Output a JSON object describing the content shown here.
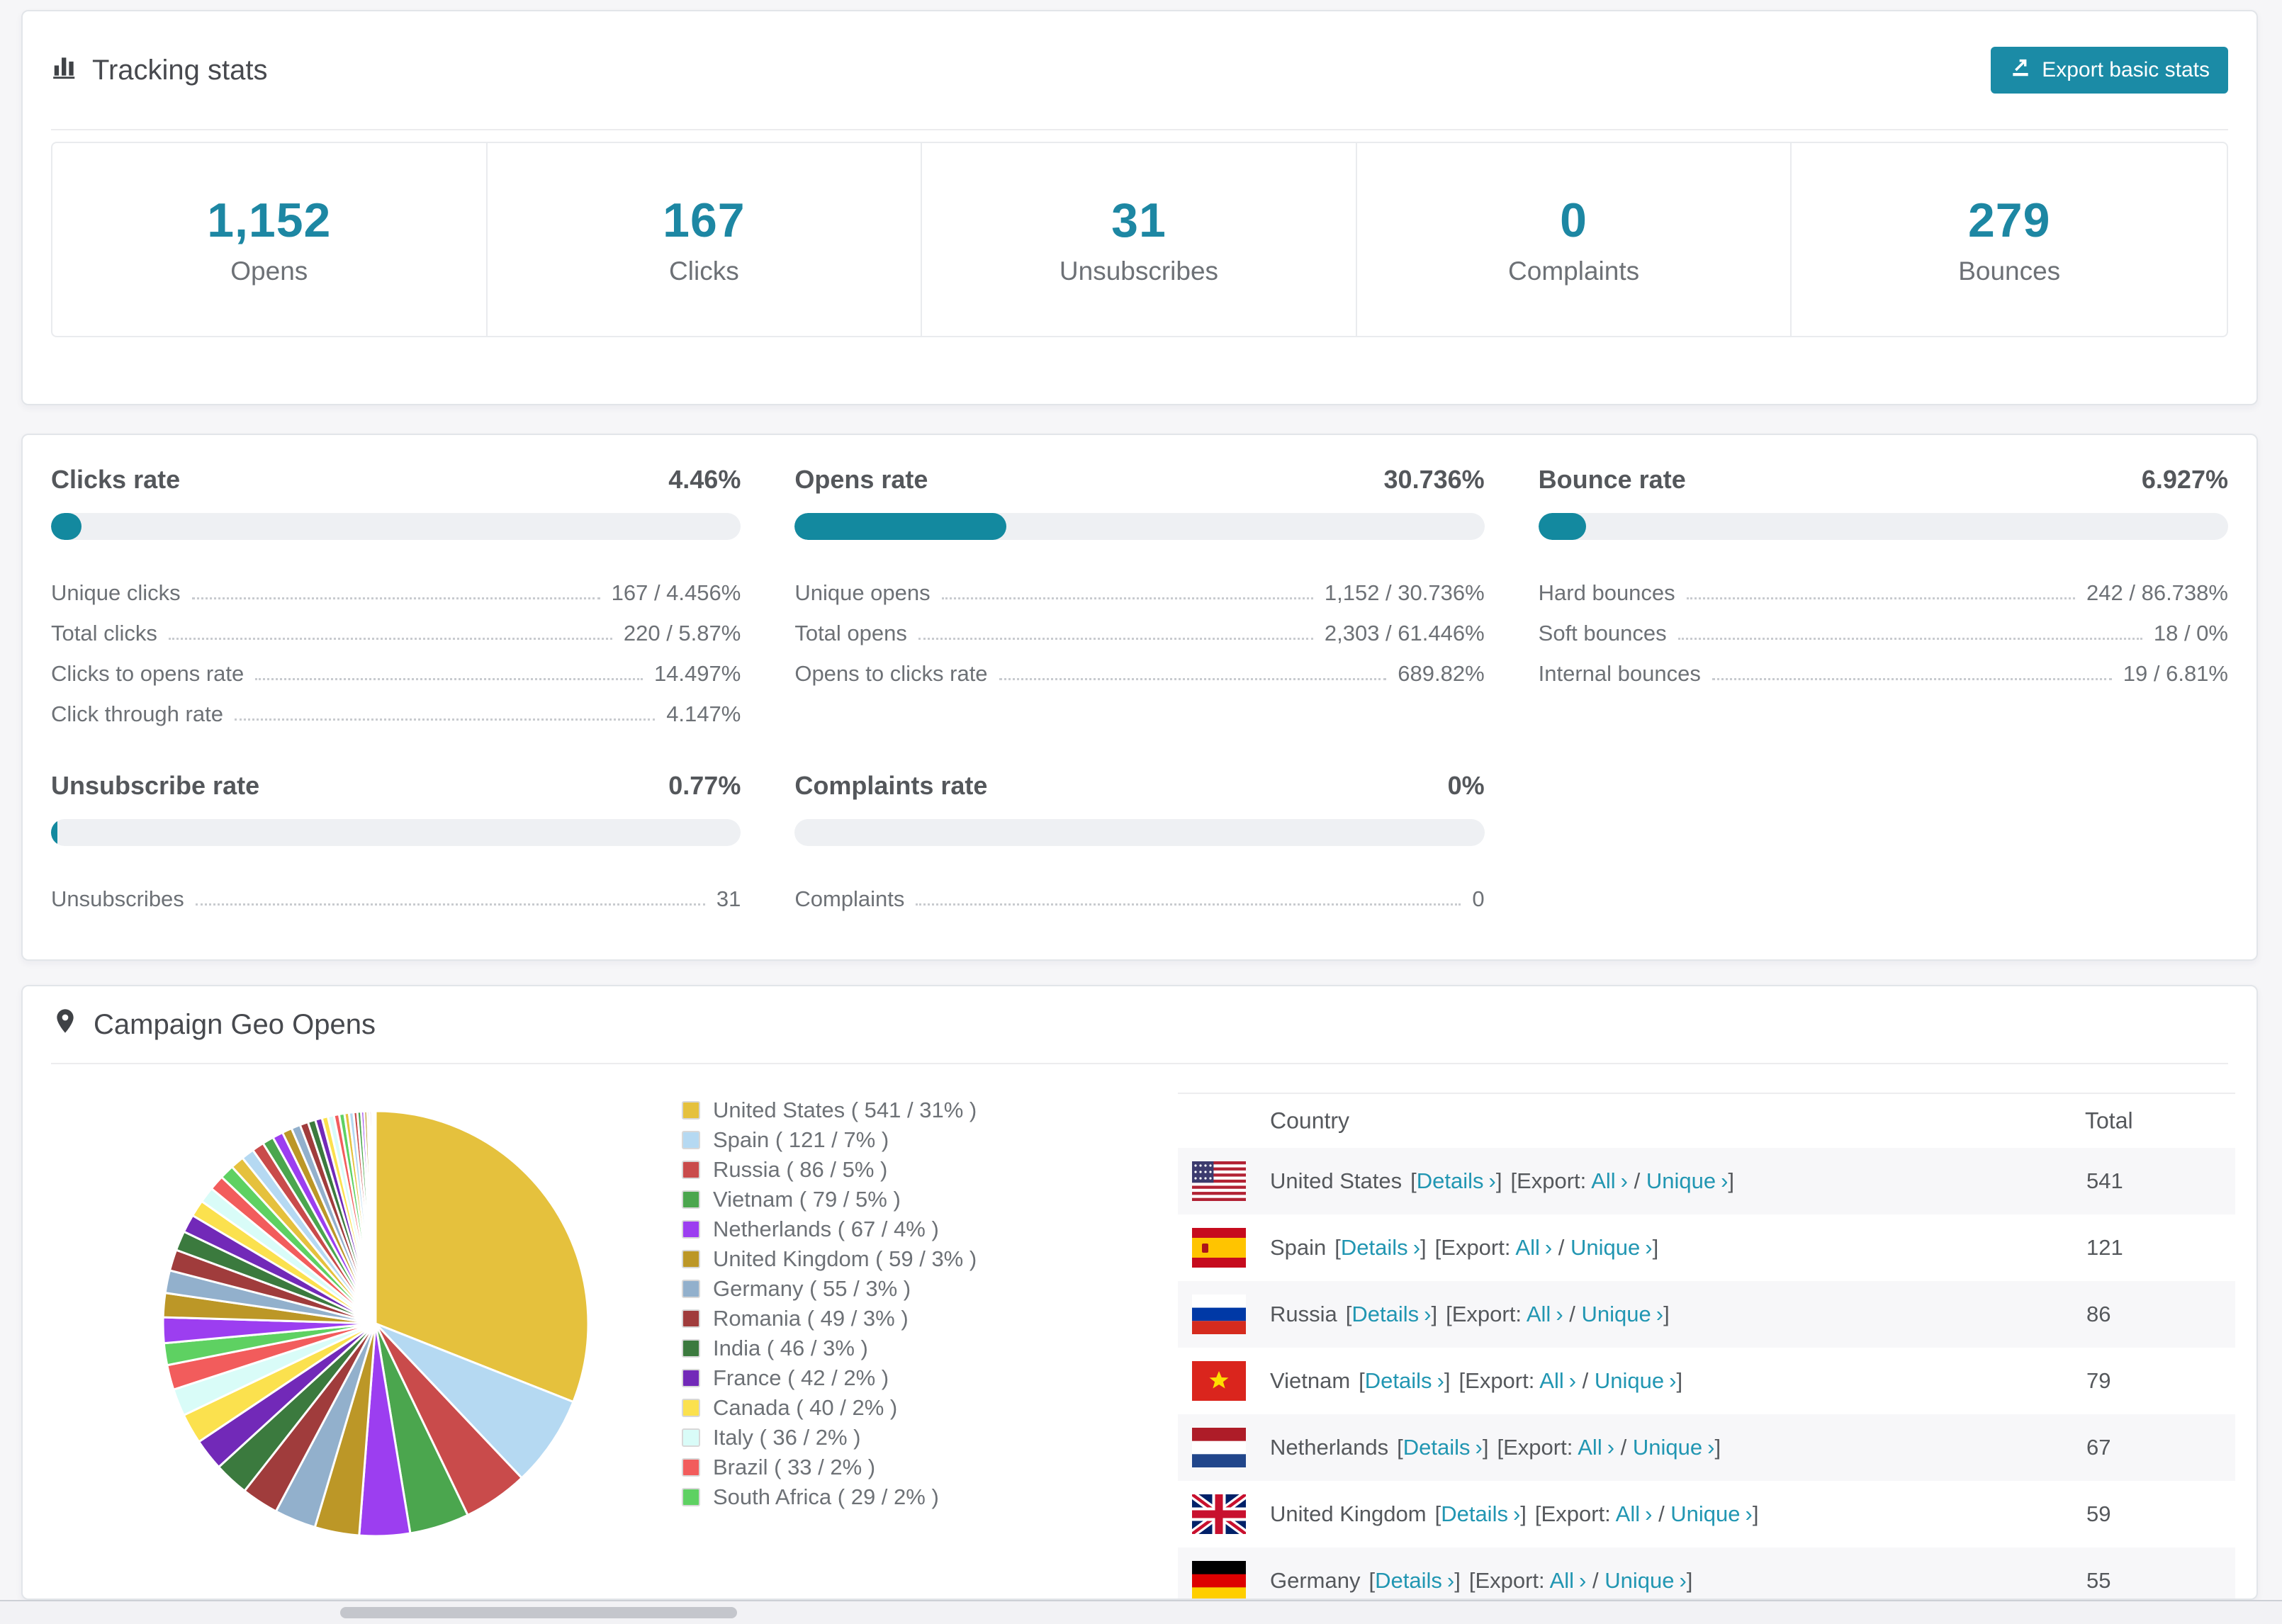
{
  "colors": {
    "accent": "#1b8ba6",
    "stat_number": "#1d87a3",
    "link": "#2196b2"
  },
  "tracking": {
    "title": "Tracking stats",
    "export_button": "Export basic stats",
    "stats": [
      {
        "value": "1,152",
        "label": "Opens"
      },
      {
        "value": "167",
        "label": "Clicks"
      },
      {
        "value": "31",
        "label": "Unsubscribes"
      },
      {
        "value": "0",
        "label": "Complaints"
      },
      {
        "value": "279",
        "label": "Bounces"
      }
    ]
  },
  "rates": {
    "sections": [
      {
        "title": "Clicks rate",
        "value": "4.46%",
        "bar_pct": 4.46,
        "rows": [
          {
            "label": "Unique clicks",
            "value": "167 / 4.456%"
          },
          {
            "label": "Total clicks",
            "value": "220 / 5.87%"
          },
          {
            "label": "Clicks to opens rate",
            "value": "14.497%"
          },
          {
            "label": "Click through rate",
            "value": "4.147%"
          }
        ]
      },
      {
        "title": "Opens rate",
        "value": "30.736%",
        "bar_pct": 30.736,
        "rows": [
          {
            "label": "Unique opens",
            "value": "1,152 / 30.736%"
          },
          {
            "label": "Total opens",
            "value": "2,303 / 61.446%"
          },
          {
            "label": "Opens to clicks rate",
            "value": "689.82%"
          }
        ]
      },
      {
        "title": "Bounce rate",
        "value": "6.927%",
        "bar_pct": 6.927,
        "rows": [
          {
            "label": "Hard bounces",
            "value": "242 / 86.738%"
          },
          {
            "label": "Soft bounces",
            "value": "18 / 0%"
          },
          {
            "label": "Internal bounces",
            "value": "19 / 6.81%"
          }
        ]
      },
      {
        "title": "Unsubscribe rate",
        "value": "0.77%",
        "bar_pct": 0.77,
        "rows": [
          {
            "label": "Unsubscribes",
            "value": "31"
          }
        ]
      },
      {
        "title": "Complaints rate",
        "value": "0%",
        "bar_pct": 0,
        "rows": [
          {
            "label": "Complaints",
            "value": "0"
          }
        ]
      }
    ]
  },
  "geo": {
    "title": "Campaign Geo Opens",
    "legend": [
      {
        "label": "United States ( 541 / 31% )",
        "color": "#e5c13d"
      },
      {
        "label": "Spain ( 121 / 7% )",
        "color": "#b5d9f2"
      },
      {
        "label": "Russia ( 86 / 5% )",
        "color": "#c94b4b"
      },
      {
        "label": "Vietnam ( 79 / 5% )",
        "color": "#4ba64e"
      },
      {
        "label": "Netherlands ( 67 / 4% )",
        "color": "#9c3ef0"
      },
      {
        "label": "United Kingdom ( 59 / 3% )",
        "color": "#bc9727"
      },
      {
        "label": "Germany ( 55 / 3% )",
        "color": "#92b0cc"
      },
      {
        "label": "Romania ( 49 / 3% )",
        "color": "#a03c3c"
      },
      {
        "label": "India ( 46 / 3% )",
        "color": "#3b7a3e"
      },
      {
        "label": "France ( 42 / 2% )",
        "color": "#7229b8"
      },
      {
        "label": "Canada ( 40 / 2% )",
        "color": "#fbe14e"
      },
      {
        "label": "Italy ( 36 / 2% )",
        "color": "#d9fcf8"
      },
      {
        "label": "Brazil ( 33 / 2% )",
        "color": "#f25c5c"
      },
      {
        "label": "South Africa ( 29 / 2% )",
        "color": "#5ed162"
      }
    ],
    "table": {
      "columns": [
        "Country",
        "Total"
      ],
      "link_labels": {
        "open": "[",
        "close": "]",
        "chev": "›",
        "slash": "/",
        "details": "Details",
        "export": "Export:",
        "all": "All",
        "unique": "Unique"
      },
      "rows": [
        {
          "country": "United States",
          "flag": "us",
          "total": "541"
        },
        {
          "country": "Spain",
          "flag": "es",
          "total": "121"
        },
        {
          "country": "Russia",
          "flag": "ru",
          "total": "86"
        },
        {
          "country": "Vietnam",
          "flag": "vn",
          "total": "79"
        },
        {
          "country": "Netherlands",
          "flag": "nl",
          "total": "67"
        },
        {
          "country": "United Kingdom",
          "flag": "gb",
          "total": "59"
        },
        {
          "country": "Germany",
          "flag": "de",
          "total": "55"
        }
      ]
    }
  },
  "chart_data": {
    "type": "pie",
    "title": "Campaign Geo Opens",
    "legend_position": "right",
    "series": [
      {
        "label": "United States",
        "value": 541,
        "color": "#e5c13d"
      },
      {
        "label": "Spain",
        "value": 121,
        "color": "#b5d9f2"
      },
      {
        "label": "Russia",
        "value": 86,
        "color": "#c94b4b"
      },
      {
        "label": "Vietnam",
        "value": 79,
        "color": "#4ba64e"
      },
      {
        "label": "Netherlands",
        "value": 67,
        "color": "#9c3ef0"
      },
      {
        "label": "United Kingdom",
        "value": 59,
        "color": "#bc9727"
      },
      {
        "label": "Germany",
        "value": 55,
        "color": "#92b0cc"
      },
      {
        "label": "Romania",
        "value": 49,
        "color": "#a03c3c"
      },
      {
        "label": "India",
        "value": 46,
        "color": "#3b7a3e"
      },
      {
        "label": "France",
        "value": 42,
        "color": "#7229b8"
      },
      {
        "label": "Canada",
        "value": 40,
        "color": "#fbe14e"
      },
      {
        "label": "Italy",
        "value": 36,
        "color": "#d9fcf8"
      },
      {
        "label": "Brazil",
        "value": 33,
        "color": "#f25c5c"
      },
      {
        "label": "South Africa",
        "value": 29,
        "color": "#5ed162"
      }
    ],
    "other_slices_values": [
      34,
      32,
      30,
      28,
      26,
      24,
      22,
      21,
      20,
      19,
      18,
      17,
      16,
      15,
      14,
      13,
      12,
      11,
      10,
      9,
      8,
      8,
      7,
      7,
      6,
      6,
      5,
      5,
      4,
      4,
      3,
      3,
      2,
      2,
      1
    ],
    "palette": [
      "#e5c13d",
      "#b5d9f2",
      "#c94b4b",
      "#4ba64e",
      "#9c3ef0",
      "#bc9727",
      "#92b0cc",
      "#a03c3c",
      "#3b7a3e",
      "#7229b8",
      "#fbe14e",
      "#d9fcf8",
      "#f25c5c",
      "#5ed162"
    ]
  }
}
